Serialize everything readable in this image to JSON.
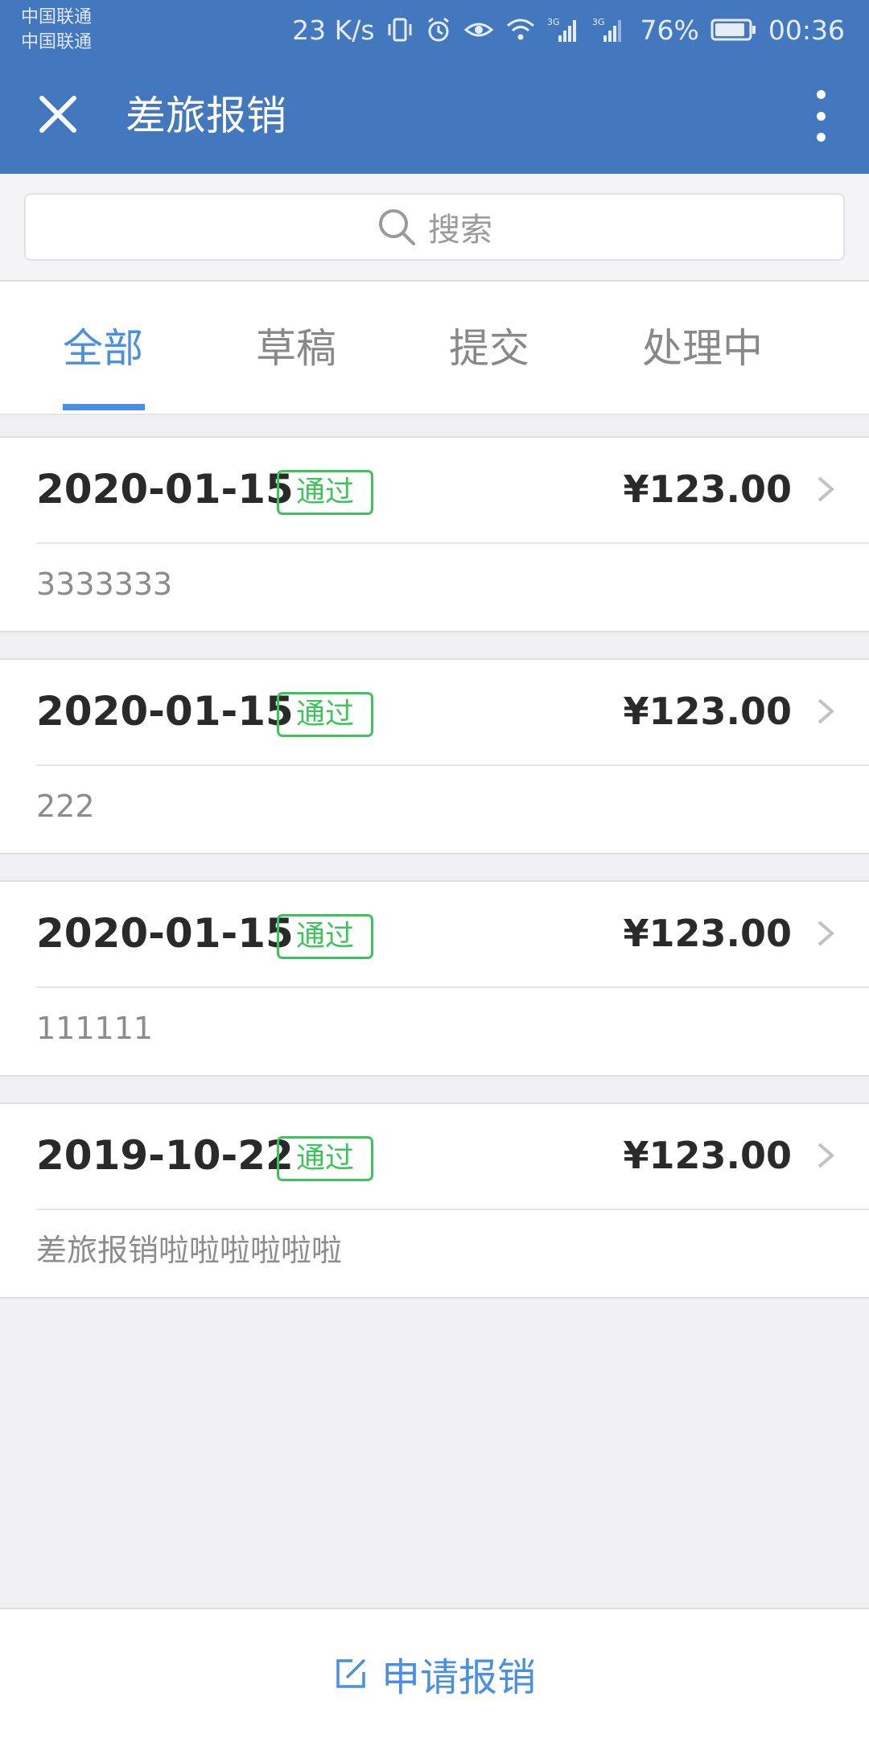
{
  "status_bar": {
    "carrier_1": "中国联通",
    "carrier_2": "中国联通",
    "net_speed": "23 K/s",
    "signal_1_type": "3G",
    "signal_2_type": "3G",
    "battery": "76%",
    "time": "00:36",
    "icons": [
      "vibrate-icon",
      "alarm-icon",
      "eye-icon",
      "wifi-icon",
      "signal-icon",
      "battery-icon"
    ]
  },
  "app_bar": {
    "title": "差旅报销",
    "close_icon": "close-icon",
    "more_icon": "more-vert-icon",
    "color": "#4378bf"
  },
  "search": {
    "placeholder": "搜索",
    "icon": "search-icon"
  },
  "tabs": [
    {
      "label": "全部",
      "active": true
    },
    {
      "label": "草稿",
      "active": false
    },
    {
      "label": "提交",
      "active": false
    },
    {
      "label": "处理中",
      "active": false
    }
  ],
  "records": [
    {
      "date": "2020-01-15",
      "status": "通过",
      "amount": "¥123.00",
      "note": "3333333"
    },
    {
      "date": "2020-01-15",
      "status": "通过",
      "amount": "¥123.00",
      "note": "222"
    },
    {
      "date": "2020-01-15",
      "status": "通过",
      "amount": "¥123.00",
      "note": "111111"
    },
    {
      "date": "2019-10-22",
      "status": "通过",
      "amount": "¥123.00",
      "note": "差旅报销啦啦啦啦啦啦"
    }
  ],
  "bottom_action": {
    "label": "申请报销",
    "icon": "edit-icon"
  },
  "colors": {
    "accent": "#4a90e2",
    "status_pass": "#3cc45a",
    "background": "#efeff4"
  }
}
